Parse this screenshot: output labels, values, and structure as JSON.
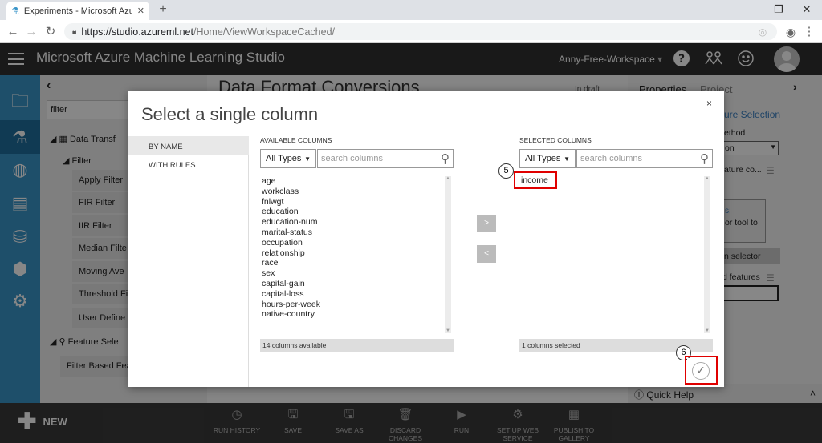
{
  "browser": {
    "tab_title": "Experiments - Microsoft Azure",
    "url_host": "https://studio.azureml.net",
    "url_path": "/Home/ViewWorkspaceCached/"
  },
  "app": {
    "title": "Microsoft Azure Machine Learning Studio",
    "workspace": "Anny-Free-Workspace",
    "workspace_caret": "▾"
  },
  "left_panel": {
    "collapse": "‹",
    "filter_placeholder": "filter",
    "tree": {
      "data_transform": "Data Transf",
      "filter": "Filter",
      "items": [
        "Apply Filter",
        "FIR Filter",
        "IIR Filter",
        "Median Filte",
        "Moving Ave",
        "Threshold Fi",
        "User Define"
      ],
      "feature_selection": "Feature Sele",
      "feature_items": [
        "Filter Based Fea"
      ]
    }
  },
  "canvas": {
    "title": "Data Format Conversions",
    "status": "In draft"
  },
  "properties": {
    "tab_properties": "Properties",
    "tab_project": "Project",
    "section": "ure Selection",
    "method_label": "ethod",
    "method_value": "on",
    "feature_label": "ature co...",
    "info_line1": "s:",
    "info_line2": "or tool to",
    "launch_button": "n selector",
    "features_label": "d features",
    "quick_help": "Quick Help"
  },
  "modal": {
    "title": "Select a single column",
    "close": "×",
    "tabs": [
      "BY NAME",
      "WITH RULES"
    ],
    "available": {
      "label": "AVAILABLE COLUMNS",
      "type_select": "All Types",
      "search_placeholder": "search columns",
      "columns": [
        "age",
        "workclass",
        "fnlwgt",
        "education",
        "education-num",
        "marital-status",
        "occupation",
        "relationship",
        "race",
        "sex",
        "capital-gain",
        "capital-loss",
        "hours-per-week",
        "native-country"
      ],
      "status": "14 columns available"
    },
    "selected": {
      "label": "SELECTED COLUMNS",
      "type_select": "All Types",
      "search_placeholder": "search columns",
      "columns": [
        "income"
      ],
      "status": "1 columns selected"
    },
    "add_button": ">",
    "remove_button": "<",
    "ok_icon": "✓"
  },
  "callouts": {
    "step5": "5",
    "step6": "6"
  },
  "bottom": {
    "new_label": "NEW",
    "commands": [
      {
        "label": "RUN HISTORY",
        "icon": "history-icon"
      },
      {
        "label": "SAVE",
        "icon": "save-icon"
      },
      {
        "label": "SAVE AS",
        "icon": "save-as-icon"
      },
      {
        "label": "DISCARD CHANGES",
        "icon": "trash-icon"
      },
      {
        "label": "RUN",
        "icon": "play-icon"
      },
      {
        "label": "SET UP WEB SERVICE",
        "icon": "web-service-icon"
      },
      {
        "label": "PUBLISH TO GALLERY",
        "icon": "gallery-icon"
      }
    ]
  },
  "colors": {
    "rail": "#3a95c9",
    "header": "#303030",
    "highlight": "#e00000"
  }
}
